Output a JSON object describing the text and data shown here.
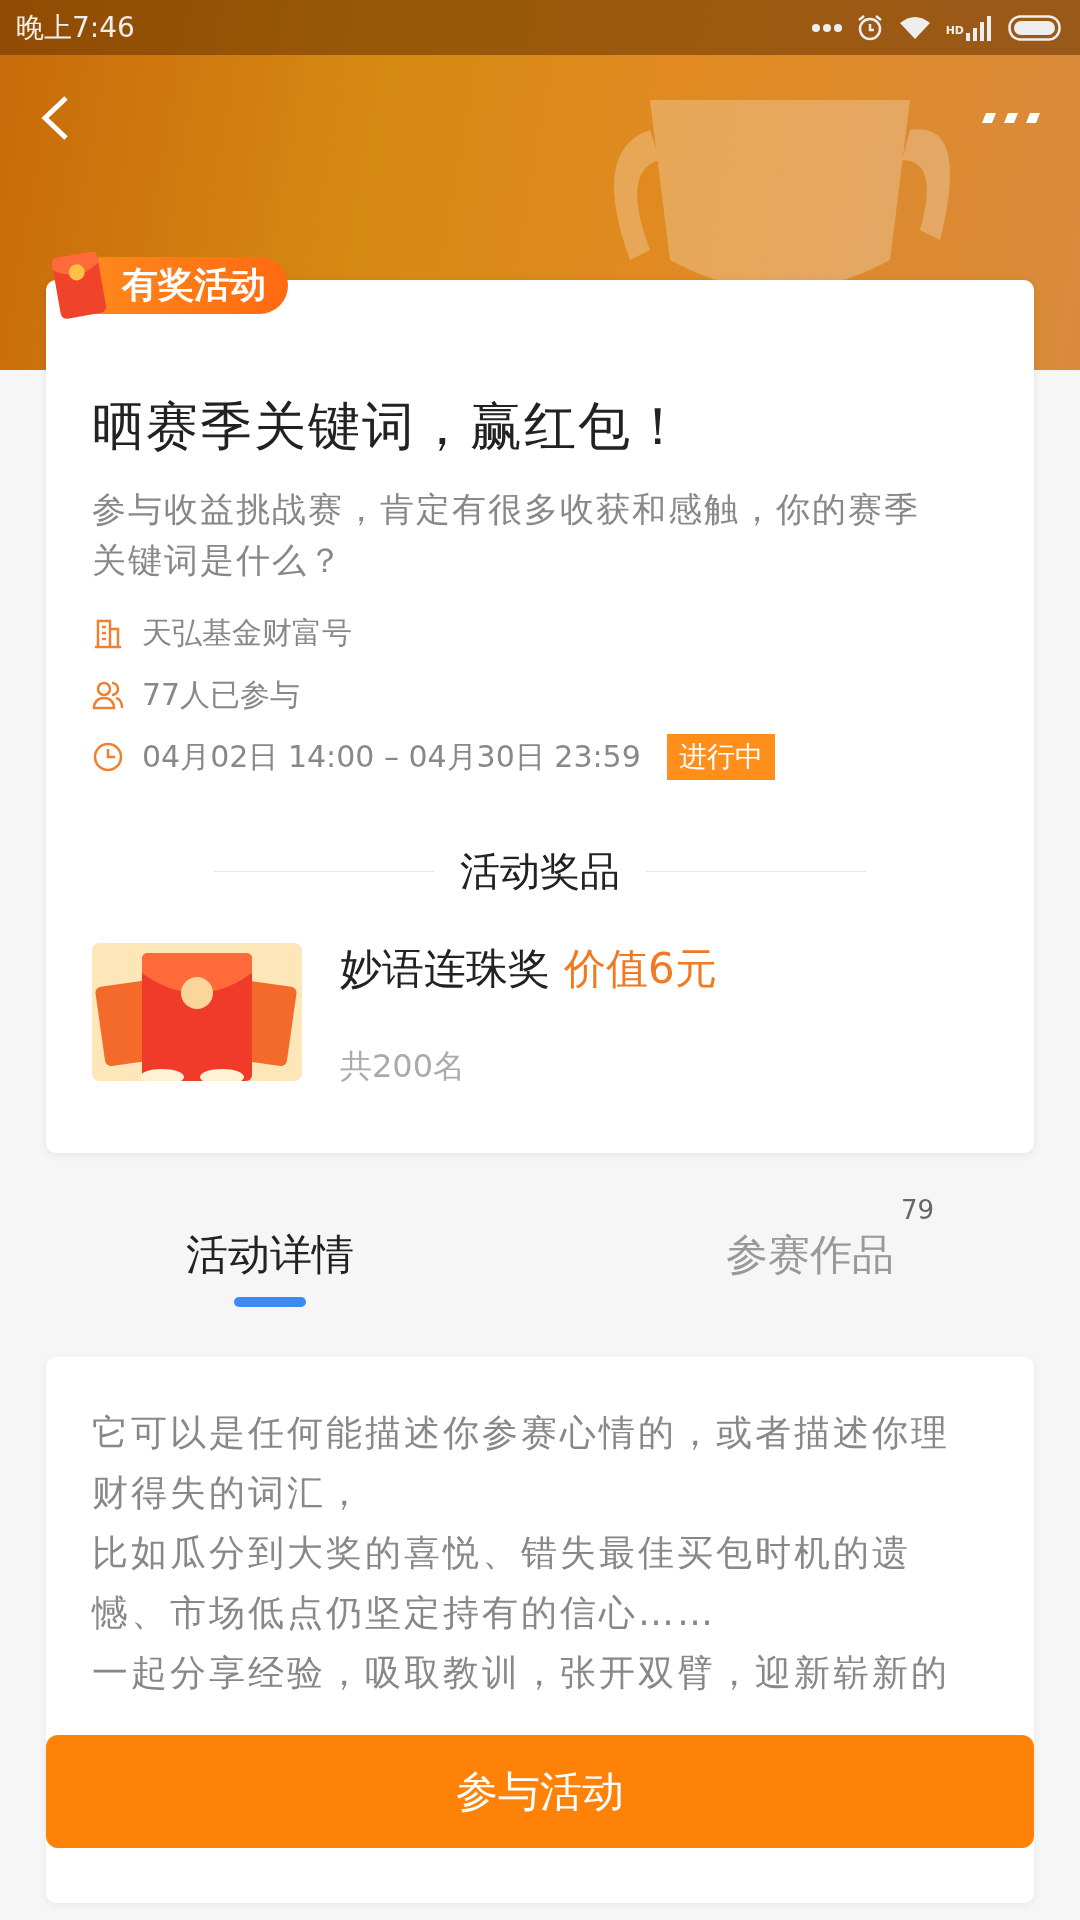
{
  "status_bar": {
    "time": "晚上7:46",
    "network_label": "HD"
  },
  "badge": {
    "label": "有奖活动"
  },
  "activity": {
    "title": "晒赛季关键词，赢红包！",
    "description": "参与收益挑战赛，肯定有很多收获和感触，你的赛季关键词是什么？",
    "info": [
      {
        "kind": "organizer",
        "text": "天弘基金财富号"
      },
      {
        "kind": "participants",
        "text": "77人已参与"
      },
      {
        "kind": "time",
        "text": "04月02日 14:00 – 04月30日 23:59",
        "status": "进行中"
      }
    ]
  },
  "prizes": {
    "heading": "活动奖品",
    "items": [
      {
        "kind": "picture",
        "name": "妙语连珠奖",
        "value": "价值6元",
        "count": "共200名"
      }
    ]
  },
  "tabs": [
    {
      "label": "活动详情",
      "selected": true
    },
    {
      "label": "参赛作品",
      "selected": false,
      "count": "79"
    }
  ],
  "details": {
    "paragraphs": [
      "它可以是任何能描述你参赛心情的，或者描述你理财得失的词汇，",
      "比如瓜分到大奖的喜悦、错失最佳买包时机的遗憾、市场低点仍坚定持有的信心……",
      "一起分享经验，吸取教训，张开双臂，迎新崭新的"
    ]
  },
  "action_button": {
    "label": "参与活动"
  }
}
